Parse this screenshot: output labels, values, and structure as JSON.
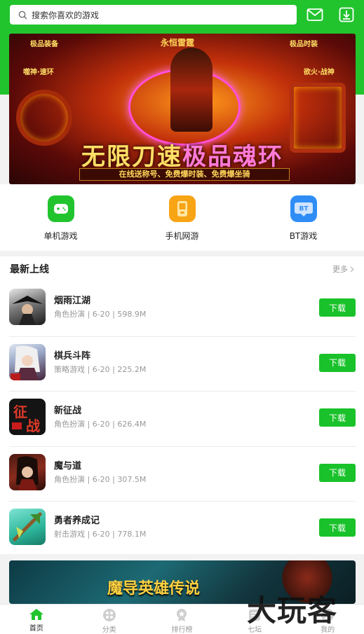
{
  "search": {
    "placeholder": "搜索你喜欢的游戏"
  },
  "banner": {
    "game_name": "永恒雷霆",
    "left_tag": "极品装备",
    "right_tag": "极品时装",
    "left_skill": "噬神·速环",
    "right_skill": "欲火·战神",
    "title_part1": "无限刀速",
    "title_part2": "极品魂环",
    "subtitle": "在线送称号、免费爆时装、免费爆坐骑"
  },
  "categories": [
    {
      "label": "单机游戏",
      "icon": "gamepad-icon",
      "color": "#22c42e"
    },
    {
      "label": "手机网游",
      "icon": "phone-game-icon",
      "color": "#f7a415"
    },
    {
      "label": "BT游戏",
      "icon": "bt-icon",
      "color": "#2f8df5"
    }
  ],
  "newest": {
    "title": "最新上线",
    "more": "更多",
    "games": [
      {
        "name": "烟雨江湖",
        "meta": "角色扮演 | 6-20 | 598.9M",
        "button": "下载"
      },
      {
        "name": "棋兵斗阵",
        "meta": "策略游戏 | 6-20 | 225.2M",
        "button": "下载"
      },
      {
        "name": "新征战",
        "meta": "角色扮演 | 6-20 | 626.4M",
        "button": "下载"
      },
      {
        "name": "魔与道",
        "meta": "角色扮演 | 6-20 | 307.5M",
        "button": "下载"
      },
      {
        "name": "勇者养成记",
        "meta": "射击游戏 | 6-20 | 778.1M",
        "button": "下载"
      }
    ]
  },
  "promo": {
    "title": "魔导英雄传说"
  },
  "tabs": [
    {
      "label": "首页",
      "icon": "home-icon",
      "active": true
    },
    {
      "label": "分类",
      "icon": "category-icon",
      "active": false
    },
    {
      "label": "排行榜",
      "icon": "ranking-icon",
      "active": false
    },
    {
      "label": "七坛",
      "icon": "forum-icon",
      "active": false
    },
    {
      "label": "我的",
      "icon": "profile-icon",
      "active": false
    }
  ],
  "watermark": "大玩客",
  "colors": {
    "brand_green": "#22c42e",
    "button_green": "#19c22a"
  }
}
